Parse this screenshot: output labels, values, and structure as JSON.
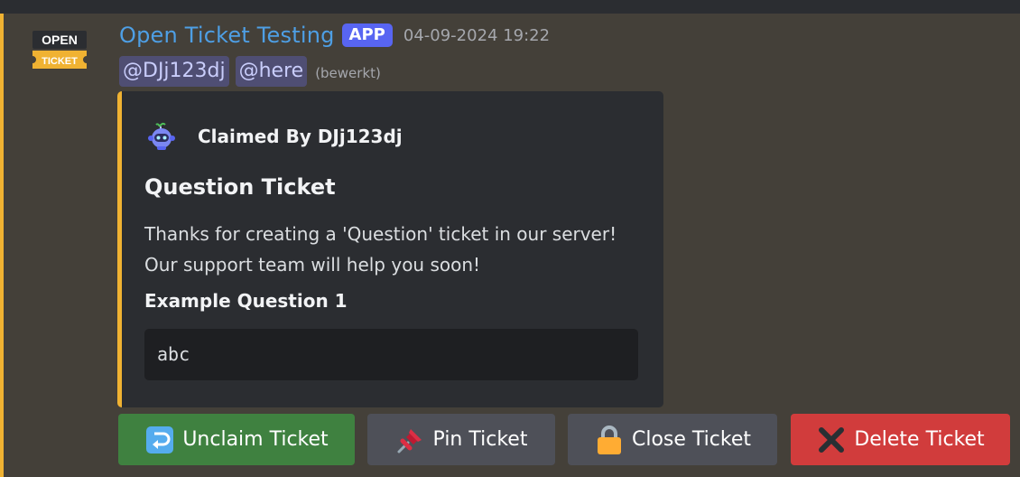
{
  "message": {
    "author": "Open Ticket Testing",
    "badge": "APP",
    "timestamp": "04-09-2024 19:22",
    "mentions": [
      "@DJj123dj",
      "@here"
    ],
    "edited_label": "(bewerkt)",
    "avatar_text_top": "OPEN",
    "avatar_text_bottom": "TICKET"
  },
  "embed": {
    "author_name": "Claimed By DJj123dj",
    "title": "Question Ticket",
    "description_line1": "Thanks for creating a 'Question' ticket in our server!",
    "description_line2": "Our support team will help you soon!",
    "field_name": "Example Question 1",
    "field_value": "abc",
    "accent_color": "#f0b232"
  },
  "buttons": {
    "unclaim": {
      "label": "Unclaim Ticket",
      "icon": "leftwards-arrow-icon",
      "color": "#3f8140"
    },
    "pin": {
      "label": "Pin Ticket",
      "icon": "pushpin-icon",
      "color": "#4e5058"
    },
    "close": {
      "label": "Close Ticket",
      "icon": "lock-icon",
      "color": "#4e5058"
    },
    "delete": {
      "label": "Delete Ticket",
      "icon": "cross-mark-icon",
      "color": "#d13c3c"
    }
  }
}
